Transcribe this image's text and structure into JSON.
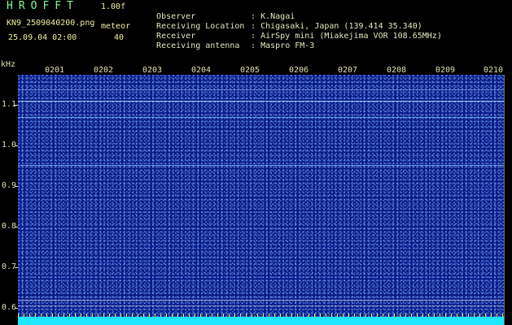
{
  "header": {
    "app_title": "HROFFT",
    "version": "1.00f",
    "filename": "KN9_2509040200.png",
    "meteor_label": "meteor",
    "meteor_count": "40",
    "datetime": "25.09.04 02:00"
  },
  "info": [
    {
      "key": "Observer",
      "value": ": K.Nagai"
    },
    {
      "key": "Receiving Location",
      "value": ": Chigasaki, Japan (139.414 35.340)"
    },
    {
      "key": "Receiver",
      "value": ": AirSpy mini (Miakejima VOR 108.65MHz)"
    },
    {
      "key": "Receiving antenna",
      "value": ": Maspro FM-3"
    }
  ],
  "axis": {
    "y_unit": "kHz",
    "y_ticks": [
      "1.1",
      "1.0",
      "0.9",
      "0.8",
      "0.7",
      "0.6"
    ],
    "x_ticks": [
      "0201",
      "0202",
      "0203",
      "0204",
      "0205",
      "0206",
      "0207",
      "0208",
      "0209",
      "0210"
    ]
  },
  "colors": {
    "background": "#000000",
    "spectrogram": "#0a1c8c",
    "signal_line": "#7fe0ff",
    "bottom_strip": "#1ee8ff"
  }
}
